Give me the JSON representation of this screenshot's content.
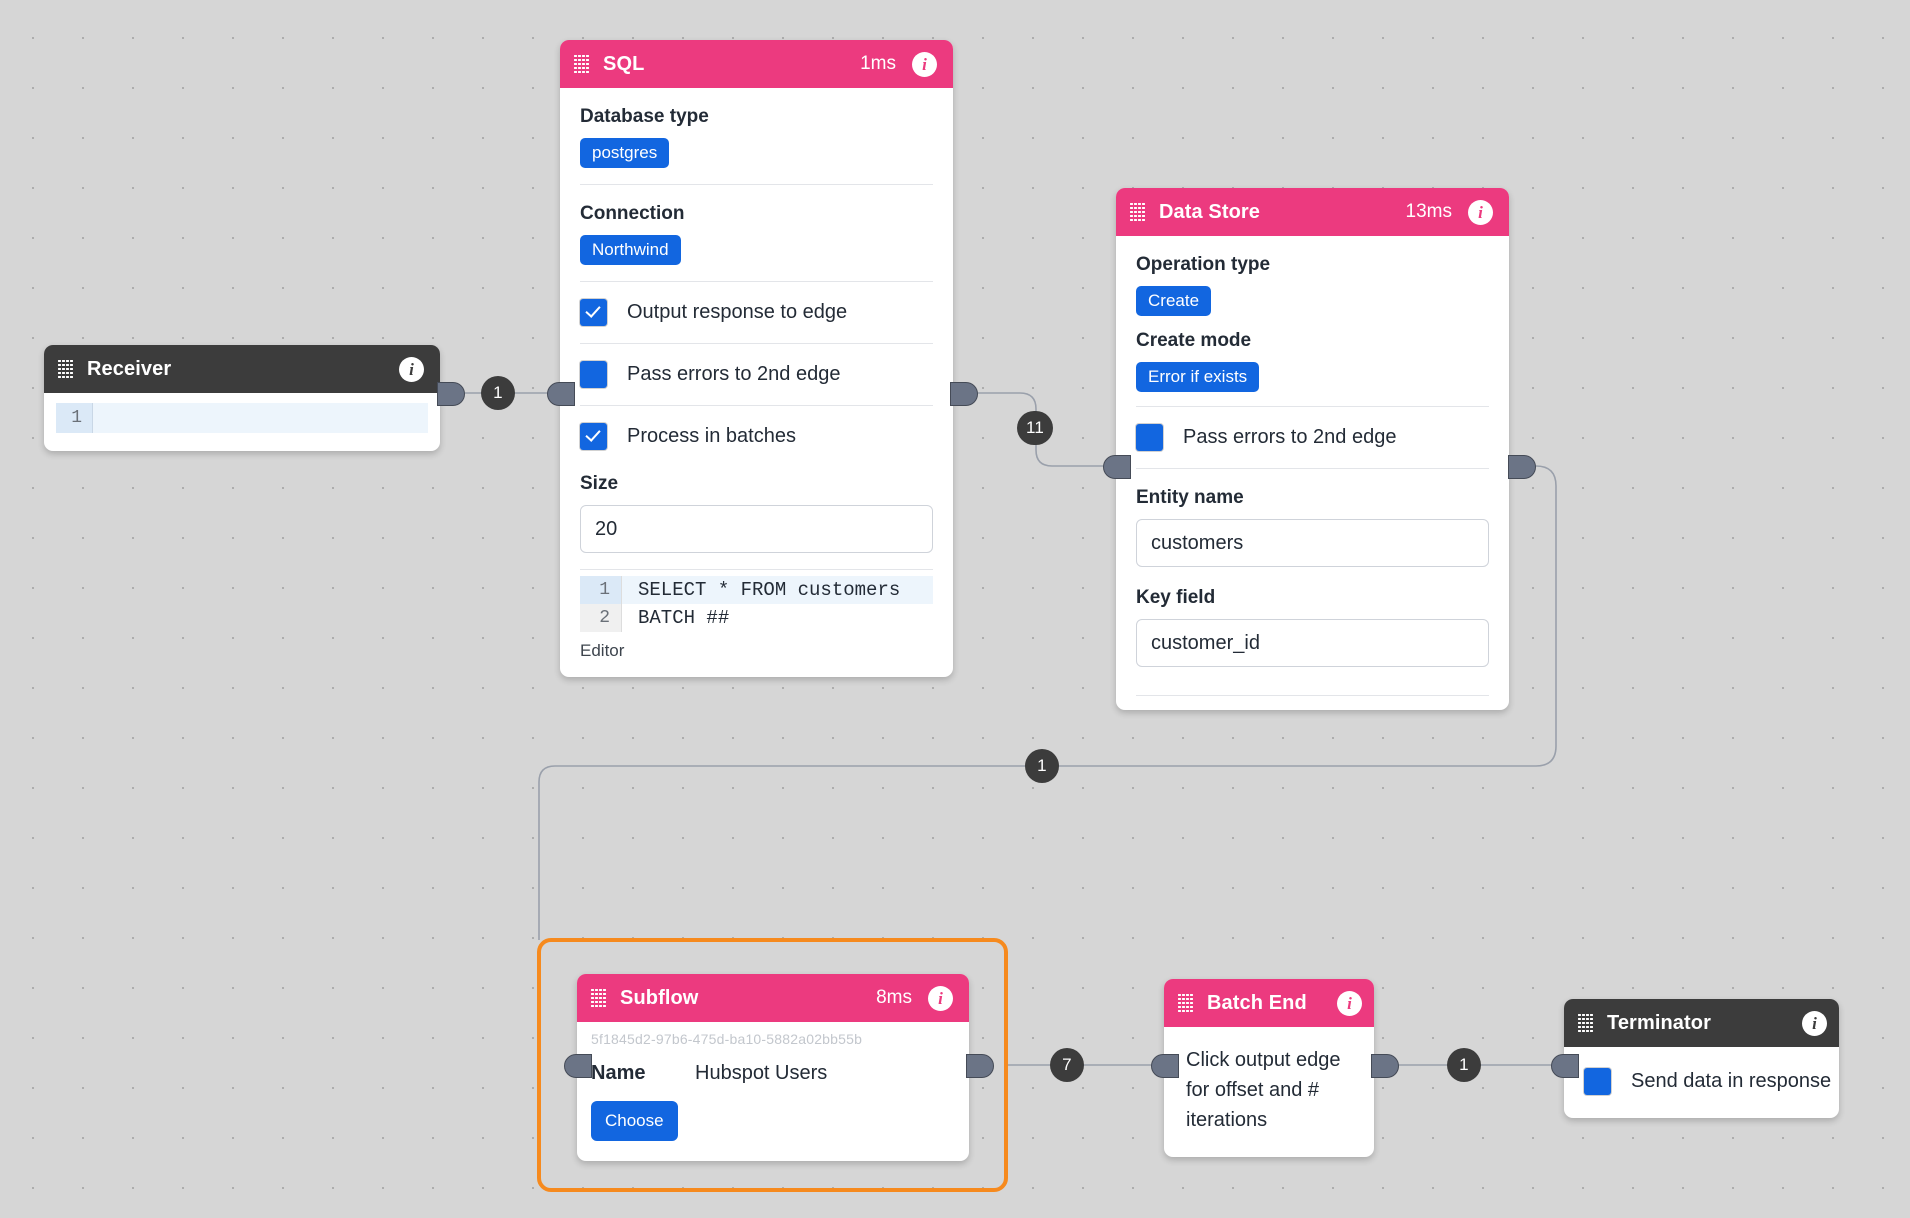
{
  "canvas": {
    "background_color": "#d6d6d6",
    "dot_color": "#adadad",
    "selection_color": "#f68a1e",
    "accent_pink": "#ec3a7f",
    "accent_blue": "#1266e0",
    "header_dark": "#3c3c3c"
  },
  "nodes": {
    "receiver": {
      "title": "Receiver",
      "header_style": "dark",
      "info_icon": "info-icon",
      "drag_icon": "drag-handle-icon",
      "code": {
        "line_number": "1",
        "text": ""
      }
    },
    "sql": {
      "title": "SQL",
      "time": "1ms",
      "header_style": "pink",
      "database_type_label": "Database type",
      "database_type_value": "postgres",
      "connection_label": "Connection",
      "connection_value": "Northwind",
      "checks": [
        {
          "label": "Output response to edge",
          "checked": true
        },
        {
          "label": "Pass errors to 2nd edge",
          "checked": false
        },
        {
          "label": "Process in batches",
          "checked": true
        }
      ],
      "size_label": "Size",
      "size_value": "20",
      "code": [
        {
          "line_number": "1",
          "text": "SELECT * FROM customers",
          "active": true
        },
        {
          "line_number": "2",
          "text": "BATCH ##",
          "active": false
        }
      ],
      "editor_caption": "Editor"
    },
    "data_store": {
      "title": "Data Store",
      "time": "13ms",
      "header_style": "pink",
      "operation_type_label": "Operation type",
      "operation_type_value": "Create",
      "create_mode_label": "Create mode",
      "create_mode_value": "Error if exists",
      "pass_errors_label": "Pass errors to 2nd edge",
      "pass_errors_checked": false,
      "entity_name_label": "Entity name",
      "entity_name_value": "customers",
      "key_field_label": "Key field",
      "key_field_value": "customer_id"
    },
    "subflow": {
      "title": "Subflow",
      "time": "8ms",
      "header_style": "pink",
      "uuid": "5f1845d2-97b6-475d-ba10-5882a02bb55b",
      "name_label": "Name",
      "name_value": "Hubspot Users",
      "choose_label": "Choose",
      "selected": true
    },
    "batch_end": {
      "title": "Batch End",
      "header_style": "pink",
      "body_text": "Click output edge for offset and # iterations"
    },
    "terminator": {
      "title": "Terminator",
      "header_style": "dark",
      "send_data_label": "Send data in response",
      "send_data_checked": false
    }
  },
  "edges": [
    {
      "id": "receiver-to-sql",
      "count": "1"
    },
    {
      "id": "sql-to-datastore",
      "count": "11"
    },
    {
      "id": "datastore-to-subflow",
      "count": "1"
    },
    {
      "id": "subflow-to-batchend",
      "count": "7"
    },
    {
      "id": "batchend-to-terminator",
      "count": "1"
    }
  ]
}
